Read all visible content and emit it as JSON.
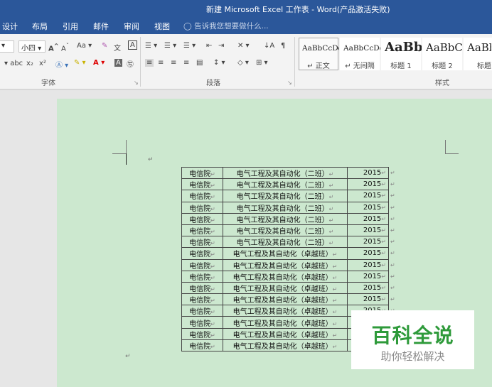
{
  "window": {
    "title": "新建 Microsoft Excel 工作表 - Word(产品激活失败)"
  },
  "menu": {
    "tabs": [
      "设计",
      "布局",
      "引用",
      "邮件",
      "审阅",
      "视图"
    ],
    "tell_me": "告诉我您想要做什么..."
  },
  "ribbon": {
    "font": {
      "size": "小四",
      "label": "字体"
    },
    "paragraph": {
      "label": "段落"
    },
    "styles": {
      "label": "样式",
      "items": [
        {
          "preview": "AaBbCcDd",
          "name": "正文"
        },
        {
          "preview": "AaBbCcDd",
          "name": "无间隔"
        },
        {
          "preview": "AaBb",
          "name": "标题 1"
        },
        {
          "preview": "AaBbC",
          "name": "标题 2"
        },
        {
          "preview": "AaBb",
          "name": "标题"
        }
      ]
    }
  },
  "table": {
    "rows": [
      [
        "电信院",
        "电气工程及其自动化（二班）",
        "2015"
      ],
      [
        "电信院",
        "电气工程及其自动化（二班）",
        "2015"
      ],
      [
        "电信院",
        "电气工程及其自动化（二班）",
        "2015"
      ],
      [
        "电信院",
        "电气工程及其自动化（二班）",
        "2015"
      ],
      [
        "电信院",
        "电气工程及其自动化（二班）",
        "2015"
      ],
      [
        "电信院",
        "电气工程及其自动化（二班）",
        "2015"
      ],
      [
        "电信院",
        "电气工程及其自动化（二班）",
        "2015"
      ],
      [
        "电信院",
        "电气工程及其自动化（卓越班）",
        "2015"
      ],
      [
        "电信院",
        "电气工程及其自动化（卓越班）",
        "2015"
      ],
      [
        "电信院",
        "电气工程及其自动化（卓越班）",
        "2015"
      ],
      [
        "电信院",
        "电气工程及其自动化（卓越班）",
        "2015"
      ],
      [
        "电信院",
        "电气工程及其自动化（卓越班）",
        "2015"
      ],
      [
        "电信院",
        "电气工程及其自动化（卓越班）",
        "2015"
      ],
      [
        "电信院",
        "电气工程及其自动化（卓越班）",
        "2015"
      ],
      [
        "电信院",
        "电气工程及其自动化（卓越班）",
        "2015"
      ],
      [
        "电信院",
        "电气工程及其自动化（卓越班）",
        "2015"
      ]
    ]
  },
  "watermark": {
    "title": "百科全说",
    "subtitle": "助你轻松解决"
  }
}
